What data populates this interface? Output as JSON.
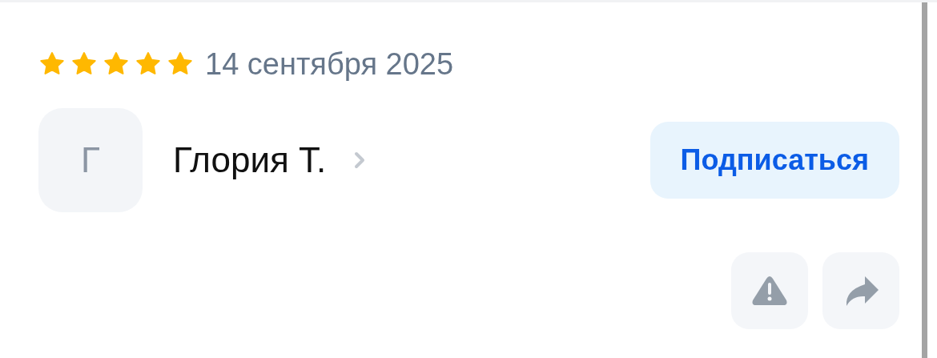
{
  "review": {
    "stars": 5,
    "date": "14 сентября 2025"
  },
  "author": {
    "initial": "Г",
    "name": "Глория Т."
  },
  "subscribe_button": "Подписаться"
}
